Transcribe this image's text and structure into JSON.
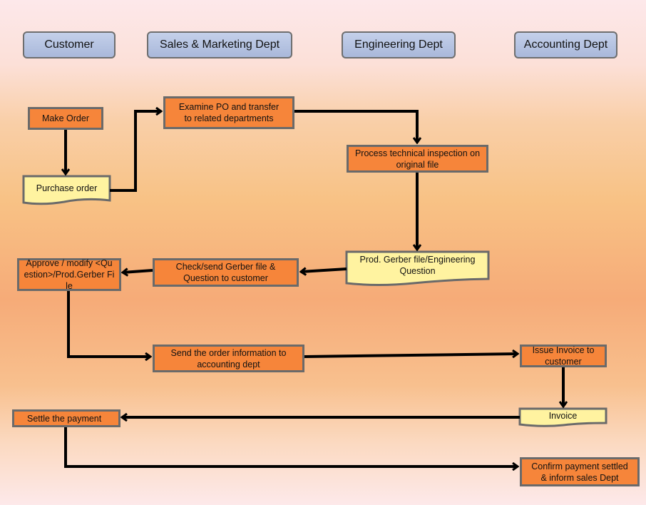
{
  "lanes": {
    "customer": "Customer",
    "sales": "Sales & Marketing Dept",
    "engineering": "Engineering Dept",
    "accounting": "Accounting Dept"
  },
  "nodes": {
    "make_order": "Make Order",
    "purchase_order": "Purchase order",
    "examine_po": "Examine PO and transfer to related departments",
    "process_inspection": "Process technical inspection on original file",
    "prod_gerber": "Prod. Gerber file/Engineering Question",
    "check_send": "Check/send Gerber  file & Question to customer",
    "approve_modify": "Approve / modify <Question>/Prod.Gerber File",
    "send_order_info": "Send the order information to accounting dept",
    "issue_invoice": "Issue Invoice to customer",
    "invoice": "Invoice",
    "settle_payment": "Settle the payment",
    "confirm_payment": "Confirm payment settled & inform sales Dept"
  },
  "colors": {
    "process": "#f6853a",
    "document": "#fff3a0",
    "lane": "#b4c2e2",
    "border": "#6a6a6a"
  }
}
